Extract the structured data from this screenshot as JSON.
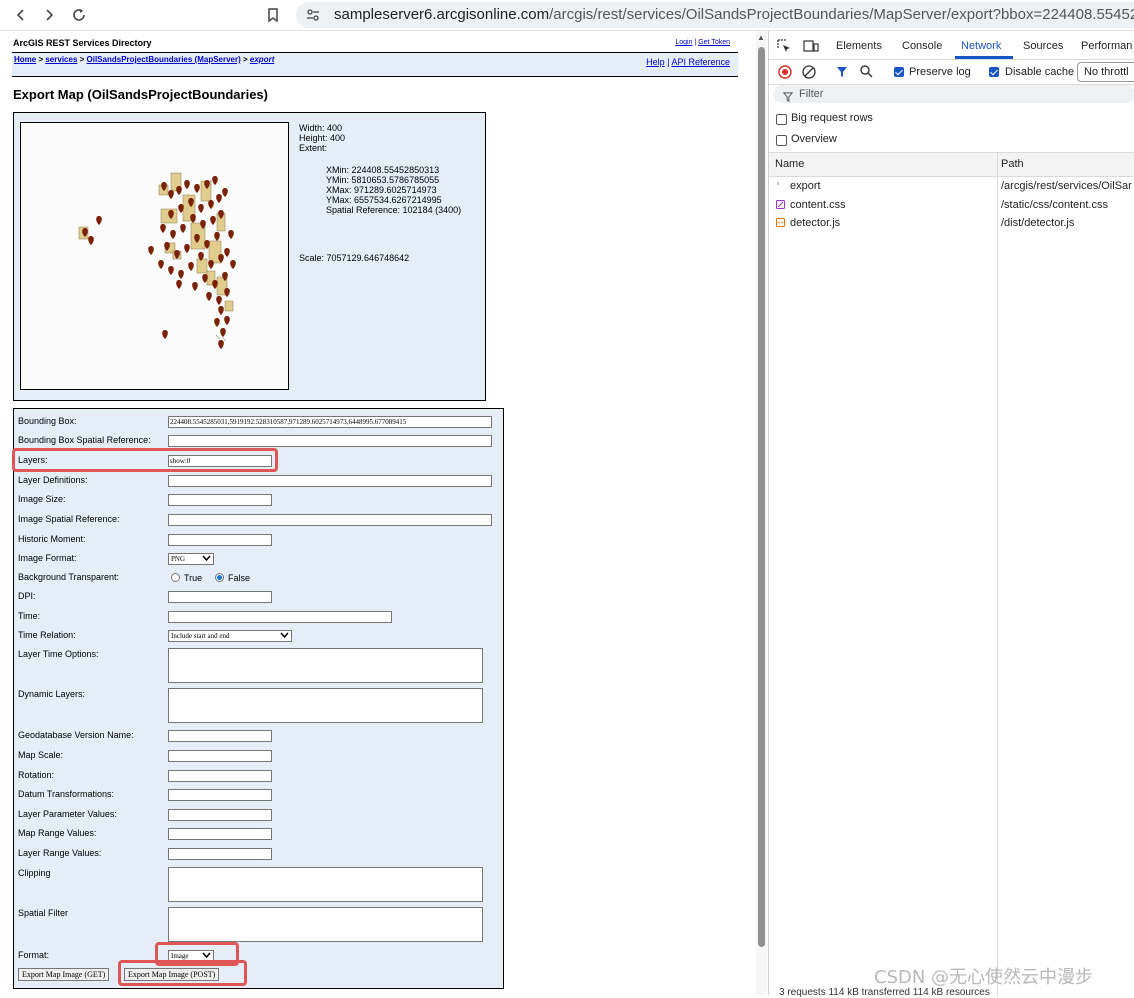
{
  "browser": {
    "url_host": "sampleserver6.arcgisonline.com",
    "url_path": "/arcgis/rest/services/OilSandsProjectBoundaries/MapServer/export?bbox=224408.5545285031"
  },
  "page": {
    "directory_title": "ArcGIS REST Services Directory",
    "login": "Login",
    "get_token": "Get Token",
    "breadcrumb": {
      "home": "Home",
      "services": "services",
      "map_server": "OilSandsProjectBoundaries (MapServer)",
      "current": "export"
    },
    "help": "Help",
    "api_reference": "API Reference",
    "title": "Export Map (OilSandsProjectBoundaries)"
  },
  "map_info": {
    "width": "Width: 400",
    "height": "Height: 400",
    "extent": "Extent:",
    "xmin": "XMin: 224408.55452850313",
    "ymin": "YMin: 5810653.5786785055",
    "xmax": "XMax: 971289.6025714973",
    "ymax": "YMax: 6557534.6267214995",
    "spatial_reference": "Spatial Reference: 102184  (3400)",
    "scale": "Scale: 7057129.646748642"
  },
  "form": {
    "bbox_label": "Bounding Box:",
    "bbox_value": "224408.5545285031,5919192.528310587,971289.6025714973,6448995.677089415",
    "bbox_sr_label": "Bounding Box Spatial Reference:",
    "layers_label": "Layers:",
    "layers_value": "show:0",
    "layer_defs_label": "Layer Definitions:",
    "image_size_label": "Image Size:",
    "image_sr_label": "Image Spatial Reference:",
    "historic_label": "Historic Moment:",
    "image_format_label": "Image Format:",
    "image_format_value": "PNG",
    "bg_transparent_label": "Background Transparent:",
    "true_label": "True",
    "false_label": "False",
    "dpi_label": "DPI:",
    "time_label": "Time:",
    "time_relation_label": "Time Relation:",
    "time_relation_value": "Include start and end",
    "layer_time_label": "Layer Time Options:",
    "dynamic_layers_label": "Dynamic Layers:",
    "gdb_version_label": "Geodatabase Version Name:",
    "map_scale_label": "Map Scale:",
    "rotation_label": "Rotation:",
    "datum_label": "Datum Transformations:",
    "layer_param_label": "Layer Parameter Values:",
    "map_range_label": "Map Range Values:",
    "layer_range_label": "Layer Range Values:",
    "clipping_label": "Clipping",
    "spatial_filter_label": "Spatial Filter",
    "format_label": "Format:",
    "format_value": "Image",
    "btn_get": "Export Map Image (GET)",
    "btn_post": "Export Map Image (POST)"
  },
  "devtools": {
    "tabs": [
      "Elements",
      "Console",
      "Network",
      "Sources",
      "Performan"
    ],
    "preserve_log": "Preserve log",
    "disable_cache": "Disable cache",
    "throttle": "No throttl",
    "filter": "Filter",
    "big_rows": "Big request rows",
    "overview": "Overview",
    "col_name": "Name",
    "col_path": "Path",
    "rows": [
      {
        "name": "export",
        "path": "/arcgis/rest/services/OilSar"
      },
      {
        "name": "content.css",
        "path": "/static/css/content.css"
      },
      {
        "name": "detector.js",
        "path": "/dist/detector.js"
      }
    ],
    "status": "3 requests   114 kB transferred   114 kB resources"
  },
  "watermark": "CSDN @无心使然云中漫步",
  "colors": {
    "accent": "#1a56c4",
    "highlight": "#e05555",
    "panel": "#e5eef7",
    "feature": "#7a2206"
  }
}
